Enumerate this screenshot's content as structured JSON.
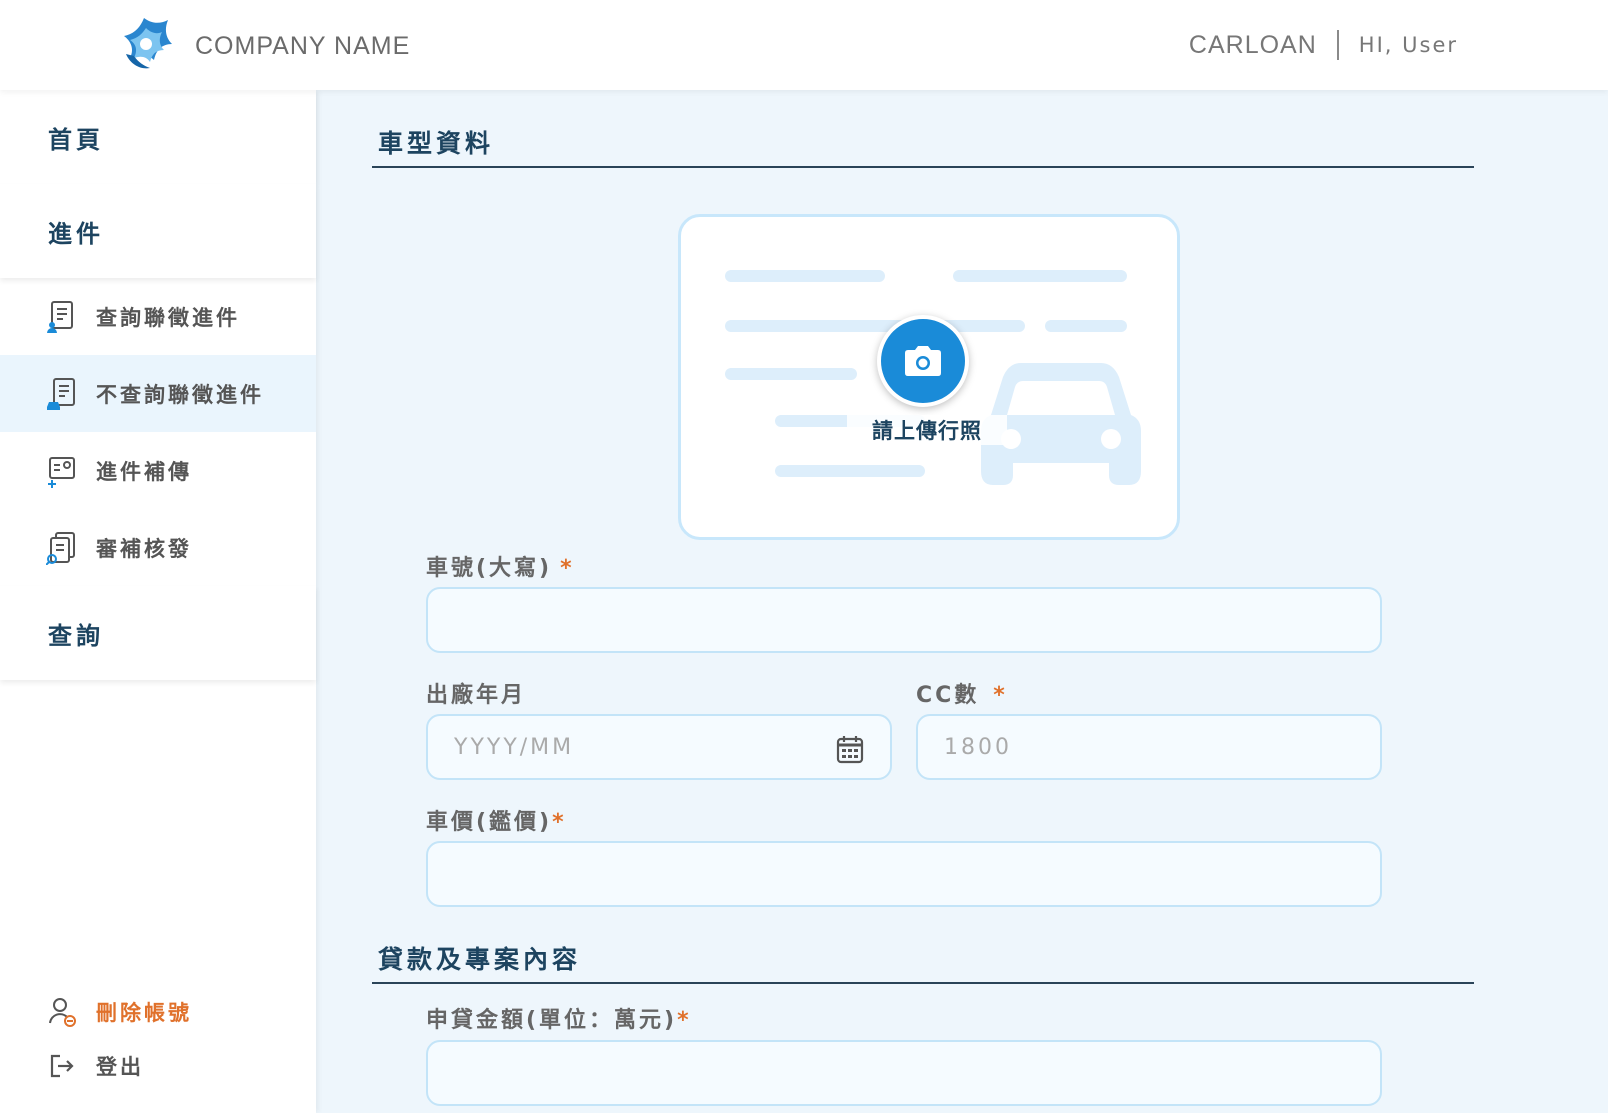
{
  "header": {
    "company_name": "COMPANY NAME",
    "app_name": "CARLOAN",
    "greeting": "HI, User"
  },
  "sidebar": {
    "sections": {
      "home": "首頁",
      "submission": "進件",
      "query": "查詢"
    },
    "items": [
      {
        "label": "查詢聯徵進件",
        "icon": "document-user-icon"
      },
      {
        "label": "不查詢聯徵進件",
        "icon": "document-car-icon",
        "active": true
      },
      {
        "label": "進件補傳",
        "icon": "id-card-add-icon"
      },
      {
        "label": "審補核發",
        "icon": "document-search-icon"
      }
    ],
    "bottom": {
      "delete_account": "刪除帳號",
      "logout": "登出"
    }
  },
  "main": {
    "vehicle_section_title": "車型資料",
    "upload_label": "請上傳行照",
    "plate_label": "車號(大寫)",
    "manufacture_label": "出廠年月",
    "manufacture_placeholder": "YYYY/MM",
    "cc_label": "CC數",
    "cc_placeholder": "1800",
    "price_label": "車價(鑑價)",
    "required_mark": "*",
    "loan_section_title": "貸款及專案內容",
    "loan_amount_label": "申貸金額(單位：萬元)"
  },
  "colors": {
    "brand_dark": "#1d4460",
    "accent_blue": "#1a8bd8",
    "danger_orange": "#e0712b",
    "page_background": "#eef6fc"
  }
}
